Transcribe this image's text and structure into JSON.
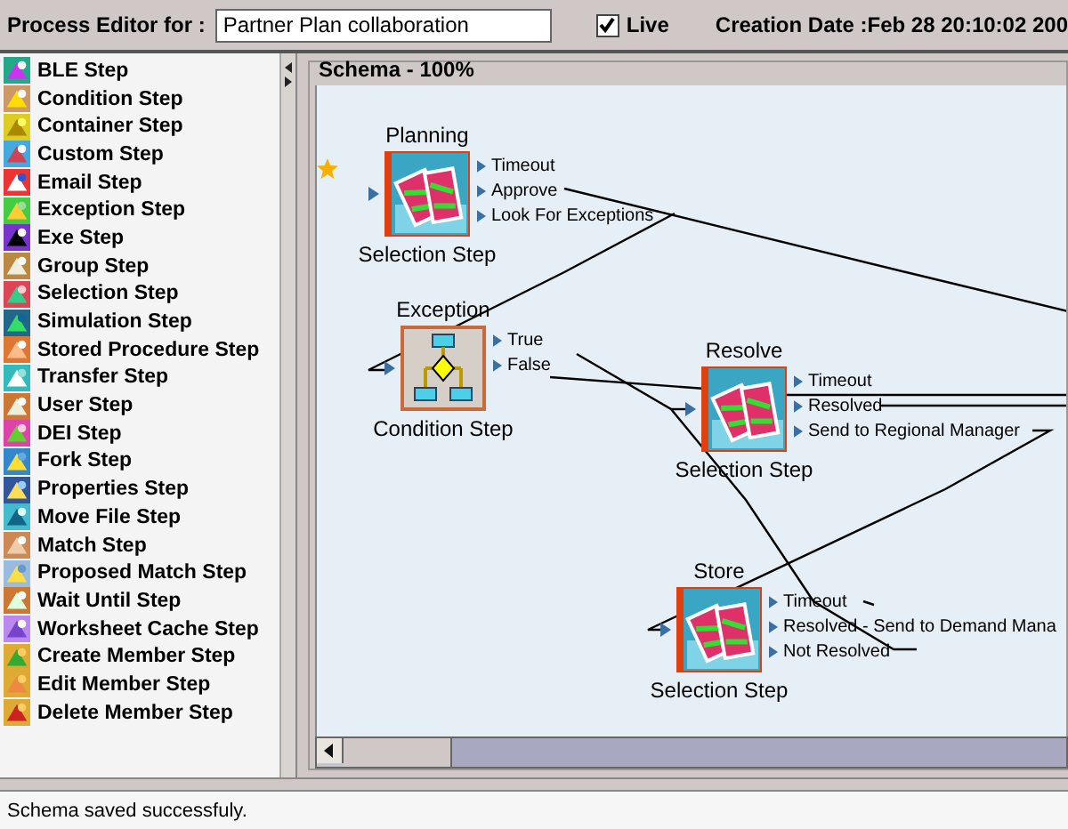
{
  "header": {
    "label": "Process Editor for :",
    "process_name": "Partner Plan collaboration",
    "live": {
      "label": "Live",
      "checked": true
    },
    "creation_date": "Creation Date :Feb 28 20:10:02 200"
  },
  "palette": {
    "items": [
      {
        "label": "BLE Step"
      },
      {
        "label": "Condition Step"
      },
      {
        "label": "Container Step"
      },
      {
        "label": "Custom Step"
      },
      {
        "label": "Email Step"
      },
      {
        "label": "Exception Step"
      },
      {
        "label": "Exe Step"
      },
      {
        "label": "Group Step"
      },
      {
        "label": "Selection Step"
      },
      {
        "label": "Simulation Step"
      },
      {
        "label": "Stored Procedure Step"
      },
      {
        "label": "Transfer Step"
      },
      {
        "label": "User Step"
      },
      {
        "label": "DEI Step"
      },
      {
        "label": "Fork Step"
      },
      {
        "label": "Properties Step"
      },
      {
        "label": "Move File Step"
      },
      {
        "label": "Match Step"
      },
      {
        "label": "Proposed Match Step"
      },
      {
        "label": "Wait Until Step"
      },
      {
        "label": "Worksheet Cache Step"
      },
      {
        "label": "Create Member Step"
      },
      {
        "label": "Edit Member Step"
      },
      {
        "label": "Delete Member Step"
      }
    ]
  },
  "schema": {
    "title": "Schema - 100%",
    "nodes": [
      {
        "name": "Planning",
        "kind": "selection",
        "type_label": "Selection Step",
        "start": true,
        "ports": [
          "Timeout",
          "Approve",
          "Look For Exceptions"
        ]
      },
      {
        "name": "Exception",
        "kind": "condition",
        "type_label": "Condition Step",
        "start": false,
        "ports": [
          "True",
          "False"
        ]
      },
      {
        "name": "Resolve",
        "kind": "selection",
        "type_label": "Selection Step",
        "start": false,
        "ports": [
          "Timeout",
          "Resolved",
          "Send to Regional Manager"
        ]
      },
      {
        "name": "Store",
        "kind": "selection",
        "type_label": "Selection Step",
        "start": false,
        "ports": [
          "Timeout",
          "Resolved - Send to Demand Mana",
          "Not Resolved"
        ]
      }
    ]
  },
  "status_bar": "Schema saved successfuly."
}
